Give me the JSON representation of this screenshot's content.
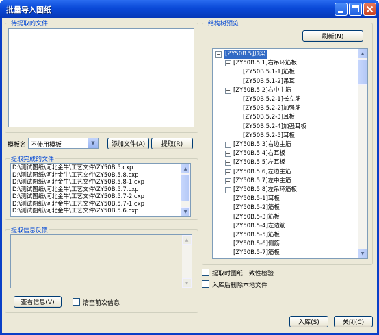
{
  "window": {
    "title": "批量导入图纸"
  },
  "left": {
    "pending_group": "待提取的文件",
    "template_label": "模板名",
    "template_value": "不使用模板",
    "add_file_button": "添加文件(A)",
    "extract_button": "提取(R)",
    "done_group": "提取完成的文件",
    "done_files": [
      "D:\\测试图纸\\河北金牛\\工艺文件\\ZY50B.5.cxp",
      "D:\\测试图纸\\河北金牛\\工艺文件\\ZY50B.5.8.cxp",
      "D:\\测试图纸\\河北金牛\\工艺文件\\ZY50B.5.8-1.cxp",
      "D:\\测试图纸\\河北金牛\\工艺文件\\ZY50B.5.7.cxp",
      "D:\\测试图纸\\河北金牛\\工艺文件\\ZY50B.5.7-2.cxp",
      "D:\\测试图纸\\河北金牛\\工艺文件\\ZY50B.5.7-1.cxp",
      "D:\\测试图纸\\河北金牛\\工艺文件\\ZY50B.5.6.cxp"
    ],
    "feedback_group": "提取信息反馈",
    "view_info_button": "查看信息(V)",
    "clear_prev_label": "清空前次信息"
  },
  "right": {
    "tree_group": "结构树预览",
    "refresh_button": "刷新(N)",
    "tree": [
      {
        "label": "[ZY50B.5]顶梁",
        "level": 0,
        "toggle": "-",
        "selected": true
      },
      {
        "label": "[ZY50B.5.1]右吊环筋板",
        "level": 1,
        "toggle": "-"
      },
      {
        "label": "[ZY50B.5.1-1]筋板",
        "level": 2,
        "toggle": ""
      },
      {
        "label": "[ZY50B.5.1-2]吊耳",
        "level": 2,
        "toggle": ""
      },
      {
        "label": "[ZY50B.5.2]右中主筋",
        "level": 1,
        "toggle": "-"
      },
      {
        "label": "[ZY50B.5.2-1]长立筋",
        "level": 2,
        "toggle": ""
      },
      {
        "label": "[ZY50B.5.2-2]加强筋",
        "level": 2,
        "toggle": ""
      },
      {
        "label": "[ZY50B.5.2-3]耳板",
        "level": 2,
        "toggle": ""
      },
      {
        "label": "[ZY50B.5.2-4]加强耳板",
        "level": 2,
        "toggle": ""
      },
      {
        "label": "[ZY50B.5.2-5]耳板",
        "level": 2,
        "toggle": ""
      },
      {
        "label": "[ZY50B.5.3]右边主筋",
        "level": 1,
        "toggle": "+"
      },
      {
        "label": "[ZY50B.5.4]右耳板",
        "level": 1,
        "toggle": "+"
      },
      {
        "label": "[ZY50B.5.5]左耳板",
        "level": 1,
        "toggle": "+"
      },
      {
        "label": "[ZY50B.5.6]左边主筋",
        "level": 1,
        "toggle": "+"
      },
      {
        "label": "[ZY50B.5.7]左中主筋",
        "level": 1,
        "toggle": "+"
      },
      {
        "label": "[ZY50B.5.8]左吊环筋板",
        "level": 1,
        "toggle": "+"
      },
      {
        "label": "[ZY50B.5-1]耳板",
        "level": 1,
        "toggle": ""
      },
      {
        "label": "[ZY50B.5-2]筋板",
        "level": 1,
        "toggle": ""
      },
      {
        "label": "[ZY50B.5-3]筋板",
        "level": 1,
        "toggle": ""
      },
      {
        "label": "[ZY50B.5-4]左边筋",
        "level": 1,
        "toggle": ""
      },
      {
        "label": "[ZY50B.5-5]筋板",
        "level": 1,
        "toggle": ""
      },
      {
        "label": "[ZY50B.5-6]侧筋",
        "level": 1,
        "toggle": ""
      },
      {
        "label": "[ZY50B.5-7]筋板",
        "level": 1,
        "toggle": ""
      }
    ],
    "consistency_check_label": "提取时图纸一致性检验",
    "delete_local_label": "入库后删除本地文件",
    "import_button": "入库(S)",
    "close_button": "关闭(C)"
  },
  "colors": {
    "title_bar": "#0a49d8",
    "accent": "#0046d5",
    "selection": "#316ac5"
  },
  "icons": [
    "minimize-icon",
    "maximize-icon",
    "close-icon",
    "chevron-down-icon",
    "scroll-up-icon",
    "scroll-down-icon"
  ]
}
